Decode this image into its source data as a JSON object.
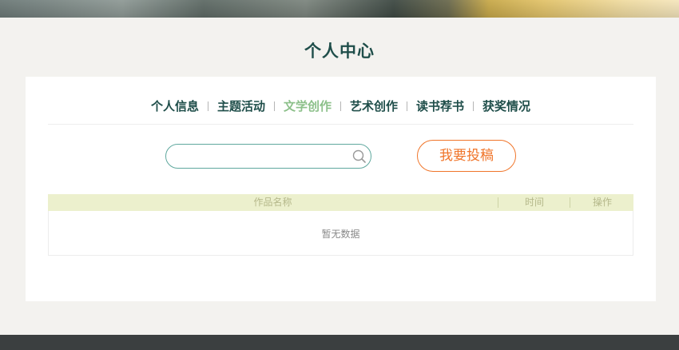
{
  "page": {
    "title": "个人中心"
  },
  "tabs": [
    {
      "label": "个人信息",
      "active": false
    },
    {
      "label": "主题活动",
      "active": false
    },
    {
      "label": "文学创作",
      "active": true
    },
    {
      "label": "艺术创作",
      "active": false
    },
    {
      "label": "读书荐书",
      "active": false
    },
    {
      "label": "获奖情况",
      "active": false
    }
  ],
  "search": {
    "value": "",
    "placeholder": ""
  },
  "actions": {
    "submit_label": "我要投稿"
  },
  "table": {
    "columns": [
      "作品名称",
      "时间",
      "操作"
    ],
    "empty_text": "暂无数据"
  },
  "colors": {
    "title": "#1f4e4a",
    "active_tab": "#8cc08a",
    "search_border": "#5fa89e",
    "submit_accent": "#f0752a",
    "table_header_bg": "#ecf0cd",
    "footer_bg": "#3b3f40"
  }
}
